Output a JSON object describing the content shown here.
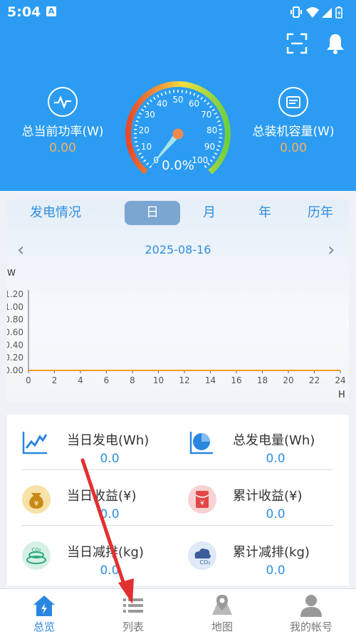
{
  "status_bar": {
    "time": "5:04",
    "notification_icon": "A"
  },
  "header": {
    "scan_icon": "scan-icon",
    "bell_icon": "bell-icon",
    "current_power": {
      "label": "总当前功率(W)",
      "value": "0.00"
    },
    "installed_capacity": {
      "label": "总装机容量(W)",
      "value": "0.00"
    },
    "gauge": {
      "percent_text": "0.0%",
      "value_percent": 0,
      "ticks": [
        "0",
        "10",
        "20",
        "30",
        "40",
        "50",
        "60",
        "70",
        "80",
        "90",
        "100"
      ]
    }
  },
  "power_card": {
    "title": "发电情况",
    "tabs": [
      "日",
      "月",
      "年",
      "历年"
    ],
    "active_tab": "日",
    "date": "2025-08-16",
    "prev_symbol": "‹",
    "next_symbol": "›"
  },
  "chart_data": {
    "type": "line",
    "x_unit": "H",
    "y_unit": "W",
    "x_ticks": [
      "0",
      "2",
      "4",
      "6",
      "8",
      "10",
      "12",
      "14",
      "16",
      "18",
      "20",
      "22",
      "24"
    ],
    "y_ticks": [
      "0.00",
      "0.20",
      "0.40",
      "0.60",
      "0.80",
      "1.00",
      "1.20"
    ],
    "xlim": [
      0,
      24
    ],
    "ylim": [
      0,
      1.2
    ],
    "series": [
      {
        "x": [
          0,
          24
        ],
        "y": [
          0,
          0
        ],
        "color": "#f39c2b"
      }
    ]
  },
  "stats": [
    {
      "label": "当日发电(Wh)",
      "value": "0.0",
      "icon": "trend-chart-icon"
    },
    {
      "label": "总发电量(Wh)",
      "value": "0.0",
      "icon": "pie-chart-icon"
    },
    {
      "label": "当日收益(¥)",
      "value": "0.0",
      "icon": "money-bag-icon"
    },
    {
      "label": "累计收益(¥)",
      "value": "0.0",
      "icon": "red-envelope-icon"
    },
    {
      "label": "当日减排(kg)",
      "value": "0.0",
      "icon": "co2-icon"
    },
    {
      "label": "累计减排(kg)",
      "value": "0.0",
      "icon": "co2-cloud-icon"
    }
  ],
  "co2_text": "CO₂",
  "yen_text": "¥",
  "nav": [
    {
      "label": "总览",
      "icon": "home-icon",
      "active": true
    },
    {
      "label": "列表",
      "icon": "list-icon",
      "active": false
    },
    {
      "label": "地图",
      "icon": "map-icon",
      "active": false
    },
    {
      "label": "我的帐号",
      "icon": "account-icon",
      "active": false
    }
  ],
  "colors": {
    "header_bg": "#2b9cf2",
    "accent_value": "#f7b05c",
    "link_blue": "#2f8ee0",
    "annotation_arrow": "#e23030"
  }
}
